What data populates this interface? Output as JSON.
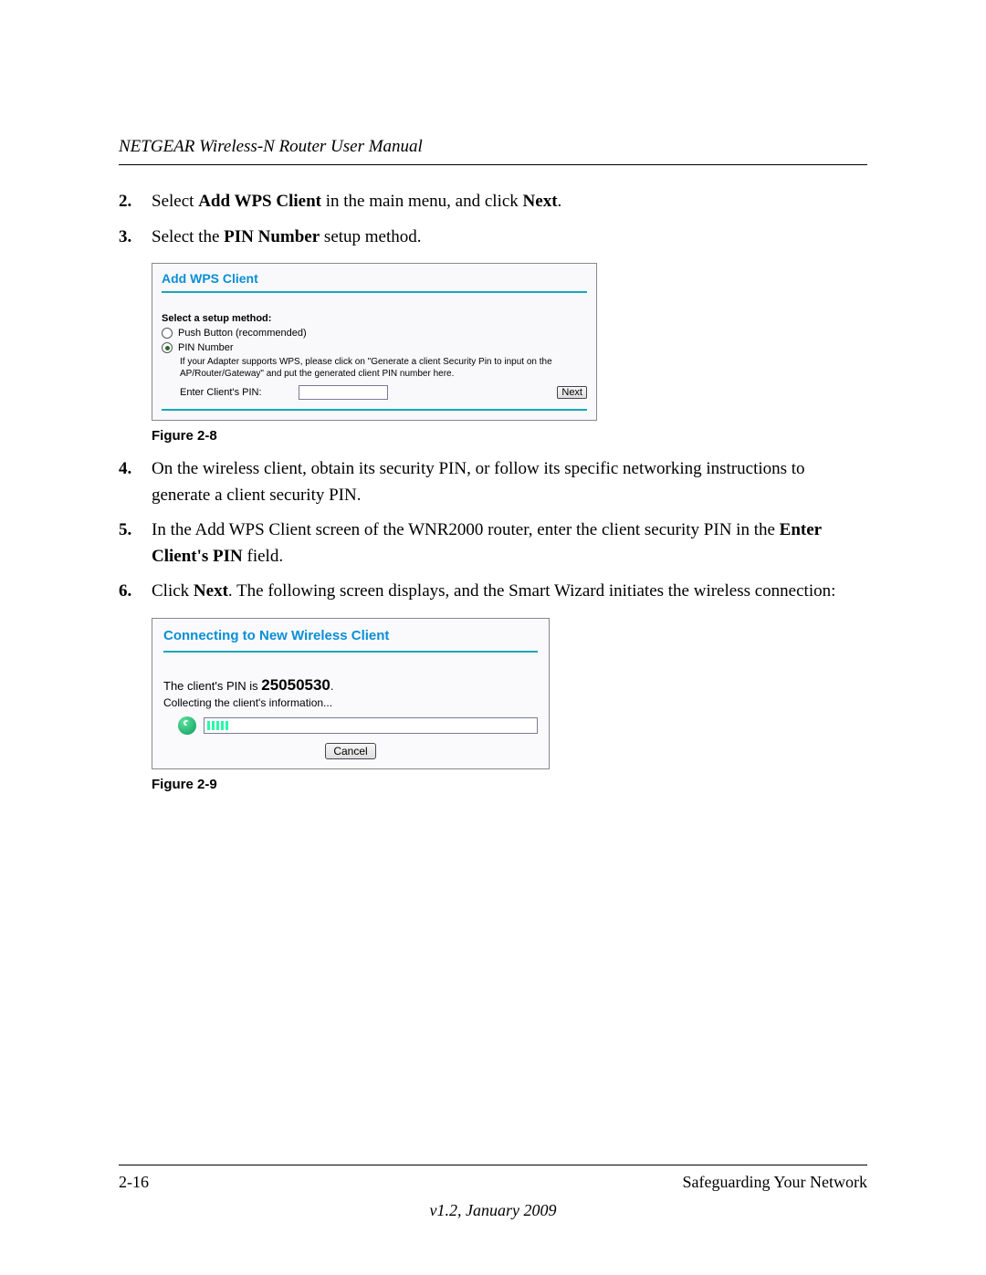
{
  "running_head": "NETGEAR Wireless-N Router User Manual",
  "steps": {
    "s2": {
      "num": "2.",
      "pre": "Select ",
      "b1": "Add WPS Client",
      "mid": " in the main menu, and click ",
      "b2": "Next",
      "post": "."
    },
    "s3": {
      "num": "3.",
      "pre": "Select the ",
      "b1": "PIN Number",
      "post": " setup method."
    },
    "s4": {
      "num": "4.",
      "text": "On the wireless client, obtain its security PIN, or follow its specific networking instructions to generate a client security PIN."
    },
    "s5": {
      "num": "5.",
      "pre": "In the Add WPS Client screen of the WNR2000 router, enter the client security PIN in the ",
      "b1": "Enter Client's PIN",
      "post": " field."
    },
    "s6": {
      "num": "6.",
      "pre": "Click ",
      "b1": "Next",
      "post": ". The following screen displays, and the Smart Wizard initiates the wireless connection:"
    }
  },
  "fig1": {
    "label": "Figure 2-8"
  },
  "fig2": {
    "label": "Figure 2-9"
  },
  "shot1": {
    "title": "Add WPS Client",
    "select_label": "Select a setup method:",
    "opt_push": "Push Button (recommended)",
    "opt_pin": "PIN Number",
    "help": "If your Adapter supports WPS, please click on \"Generate a client Security Pin to input on the AP/Router/Gateway\" and put the generated client PIN number here.",
    "enter_pin_label": "Enter Client's PIN:",
    "next_btn": "Next"
  },
  "shot2": {
    "title": "Connecting to New Wireless Client",
    "pin_pre": "The client's PIN is ",
    "pin_value": "25050530",
    "pin_post": ".",
    "collecting": "Collecting the client's information...",
    "cancel_btn": "Cancel"
  },
  "footer": {
    "page": "2-16",
    "section": "Safeguarding Your Network",
    "version": "v1.2, January 2009"
  }
}
